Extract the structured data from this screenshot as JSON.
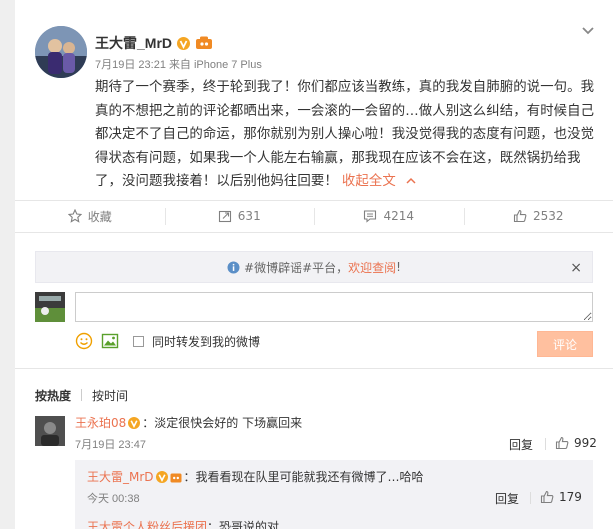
{
  "post": {
    "username": "王大雷_MrD",
    "date": "7月19日 23:21",
    "source_prefix": "来自",
    "source": "iPhone 7 Plus",
    "text": "期待了一个赛季，终于轮到我了！你们都应该当教练，真的我发自肺腑的说一句。我真的不想把之前的评论都晒出来，一会滚的一会留的…做人别这么纠结，有时候自己都决定不了自己的命运，那你就别为别人操心啦！我没觉得我的态度有问题，也没觉得状态有问题，如果我一个人能左右输赢，那我现在应该不会在这，既然锅扔给我了，没问题我接着！以后别他妈往回要！",
    "expand_label": "收起全文",
    "expand_icon": "chevron-up-icon"
  },
  "actions": {
    "favorite_label": "收藏",
    "repost_count": "631",
    "comment_count": "4214",
    "like_count": "2532"
  },
  "notice": {
    "prefix": "#微博辟谣#平台，",
    "link": "欢迎查阅",
    "suffix": "!",
    "close": "×"
  },
  "compose": {
    "placeholder": "",
    "repost_label": "同时转发到我的微博",
    "submit_label": "评论"
  },
  "sort": {
    "hot": "按热度",
    "time": "按时间"
  },
  "comment": {
    "name": "王永珀08",
    "text": "：淡定很快会好的  下场赢回来",
    "time": "7月19日 23:47",
    "reply_label": "回复",
    "likes": "992"
  },
  "sub_comment": {
    "name": "王大雷_MrD",
    "text": "：我看看现在队里可能就我还有微博了…哈哈",
    "time": "今天 00:38",
    "reply_label": "回复",
    "likes": "179",
    "next_name": "王大雷个人粉丝后援团",
    "next_text": "：恐哥说的对"
  },
  "colors": {
    "accent": "#eb7350",
    "badge_orange": "#f5a623",
    "submit_disabled": "#ffc09f",
    "panel_bg": "#f2f2f5"
  }
}
